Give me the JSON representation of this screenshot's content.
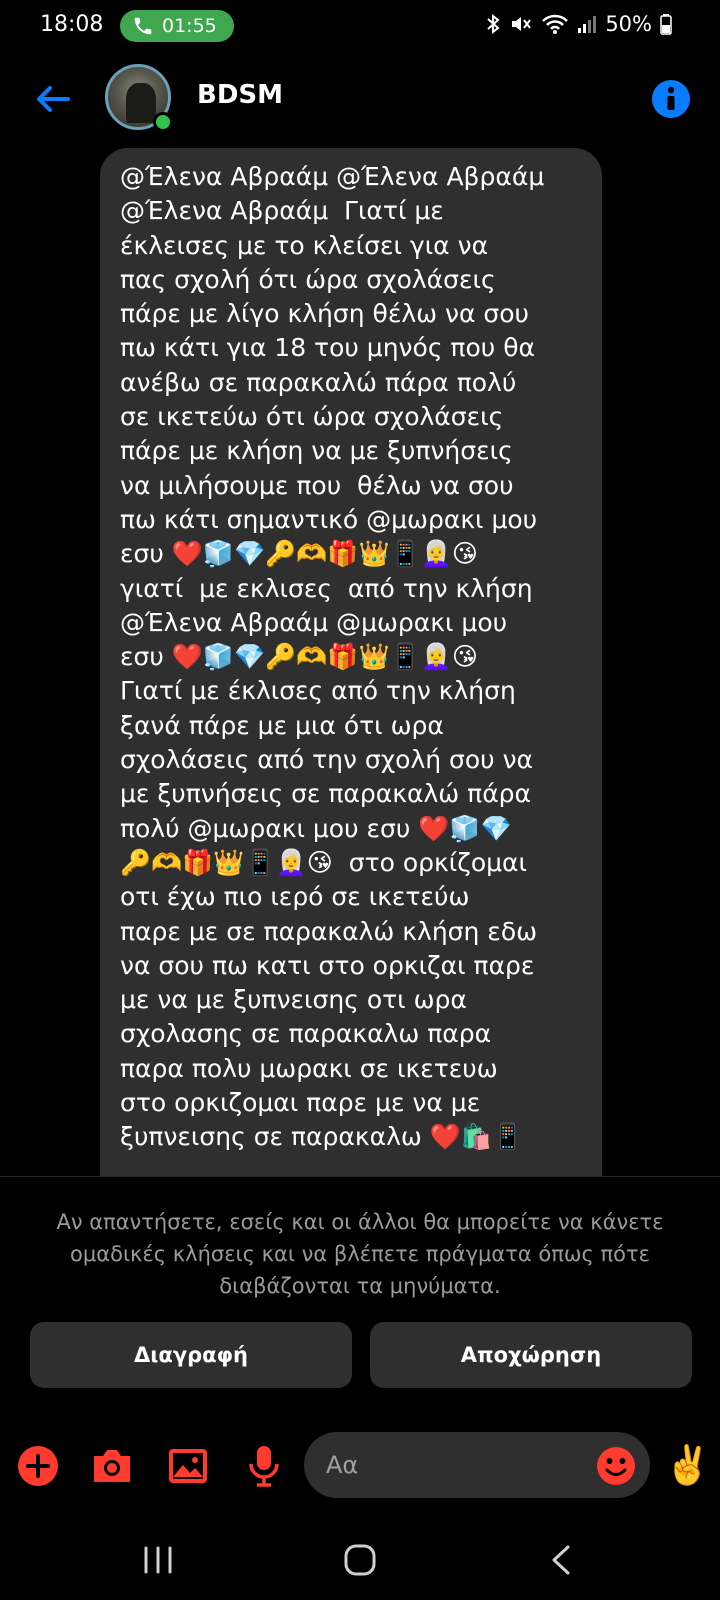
{
  "status_bar": {
    "time": "18:08",
    "call_timer": "01:55",
    "battery": "50%",
    "call_pill_color": "#3fa84e"
  },
  "header": {
    "title": "BDSM",
    "back_icon": "arrow-left-icon",
    "info_icon": "info-icon",
    "accent_color": "#0a7cff"
  },
  "message": {
    "text": "@Έλενα Αβραάμ @Έλενα Αβραάμ\n@Έλενα Αβραάμ  Γιατί με\nέκλεισες με το κλείσει για να\nπας σχολή ότι ώρα σχολάσεις\nπάρε με λίγο κλήση θέλω να σου\nπω κάτι για 18 του μηνός που θα\nανέβω σε παρακαλώ πάρα πολύ\nσε ικετεύω ότι ώρα σχολάσεις\nπάρε με κλήση να με ξυπνήσεις\nνα μιλήσουμε που  θέλω να σου\nπω κάτι σημαντικό @μωρακι μου\nεσυ ❤️🧊💎🔑🫶🎁👑📱👩‍🦳😘\nγιατί  με εκλισες  από την κλήση\n@Έλενα Αβραάμ @μωρακι μου\nεσυ ❤️🧊💎🔑🫶🎁👑📱👩‍🦳😘\nΓιατί με έκλισες από την κλήση\nξανά πάρε με μια ότι ωρα\nσχολάσεις από την σχολή σου να\nμε ξυπνήσεις σε παρακαλώ πάρα\nπολύ @μωρακι μου εσυ ❤️🧊💎\n🔑🫶🎁👑📱👩‍🦳😘  στο ορκίζομαι\nοτι έχω πιο ιερό σε ικετεύω\nπαρε με σε παρακαλώ κλήση εδω\nνα σου πω κατι στο ορκιζαι παρε\nμε να με ξυπνεισης οτι ωρα\nσχολασης σε παρακαλω παρα\nπαρα πολυ μωρακι σε ικετευω\nστο ορκιζομαι παρε με να με\nξυπνεισης σε παρακαλω ❤️🛍️📱"
  },
  "notice": {
    "text": "Αν απαντήσετε, εσείς και οι άλλοι θα μπορείτε να κάνετε ομαδικές κλήσεις και να βλέπετε πράγματα όπως πότε διαβάζονται τα μηνύματα."
  },
  "actions": {
    "delete_label": "Διαγραφή",
    "leave_label": "Αποχώρηση"
  },
  "composer": {
    "placeholder": "Αα",
    "wave_emoji": "✌️",
    "icon_color": "#ff3b30",
    "icons": [
      "plus-icon",
      "camera-icon",
      "image-icon",
      "microphone-icon",
      "emoji-icon"
    ]
  },
  "nav_bar": {
    "icons": [
      "recents-icon",
      "home-icon",
      "back-icon"
    ]
  }
}
